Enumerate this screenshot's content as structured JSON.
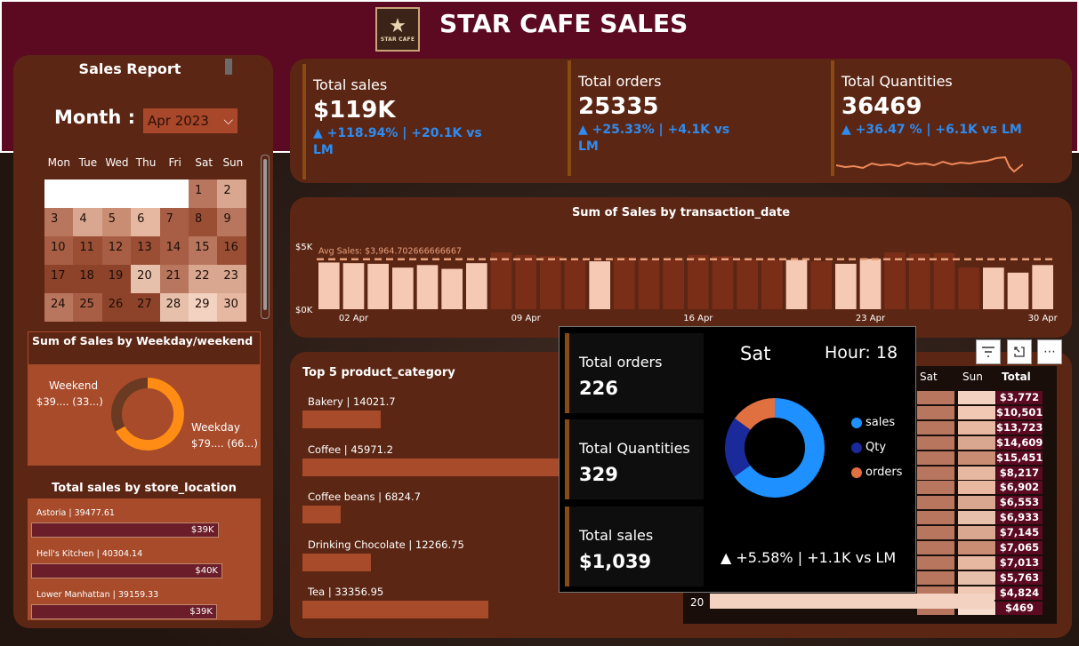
{
  "header": {
    "title": "STAR CAFE SALES",
    "logo_text": "STAR CAFE"
  },
  "sidebar": {
    "title": "Sales Report",
    "month_label": "Month :",
    "month_value": "Apr 2023",
    "weekdays": [
      "Mon",
      "Tue",
      "Wed",
      "Thu",
      "Fri",
      "Sat",
      "Sun"
    ],
    "calendar_rows": [
      [
        "",
        "",
        "",
        "",
        "",
        "1",
        "2"
      ],
      [
        "3",
        "4",
        "5",
        "6",
        "7",
        "8",
        "9"
      ],
      [
        "10",
        "11",
        "12",
        "13",
        "14",
        "15",
        "16"
      ],
      [
        "17",
        "18",
        "19",
        "20",
        "21",
        "22",
        "23"
      ],
      [
        "24",
        "25",
        "26",
        "27",
        "28",
        "29",
        "30"
      ]
    ],
    "calendar_shades": [
      [
        "#ffffff",
        "#ffffff",
        "#ffffff",
        "#ffffff",
        "#ffffff",
        "#b9765e",
        "#d9a68f"
      ],
      [
        "#b9765e",
        "#d9a68f",
        "#c98d74",
        "#e6b8a2",
        "#a85e44",
        "#9a4f35",
        "#b9765e"
      ],
      [
        "#a85e44",
        "#9a4f35",
        "#a85e44",
        "#9a4f35",
        "#a85e44",
        "#b9765e",
        "#9a4f35"
      ],
      [
        "#8d4329",
        "#8d4329",
        "#8d4329",
        "#e6c0ab",
        "#b9765e",
        "#d9a68f",
        "#d9a68f"
      ],
      [
        "#b9765e",
        "#a85e44",
        "#8d4329",
        "#8d4329",
        "#e6c0ab",
        "#f3d2c1",
        "#e6b8a2"
      ]
    ]
  },
  "weekday_panel": {
    "title": "Sum of Sales by Weekday/weekend",
    "weekend_label": "Weekend",
    "weekend_value": "$39.... (33...)",
    "weekday_label": "Weekday",
    "weekday_value": "$79.... (66...)",
    "weekend_share": 0.33,
    "colors": {
      "weekday": "#ff8c14",
      "weekend": "#6b3a22"
    }
  },
  "store_panel": {
    "title": "Total sales by store_location",
    "stores": [
      {
        "label": "Astoria | 39477.61",
        "value": 39477.61,
        "badge": "$39K"
      },
      {
        "label": "Hell's Kitchen | 40304.14",
        "value": 40304.14,
        "badge": "$40K"
      },
      {
        "label": "Lower Manhattan | 39159.33",
        "value": 39159.33,
        "badge": "$39K"
      }
    ]
  },
  "kpis": [
    {
      "label": "Total sales",
      "value": "$119K",
      "delta": "▲ +118.94% | +20.1K vs LM"
    },
    {
      "label": "Total orders",
      "value": "25335",
      "delta": "▲ +25.33% | +4.1K vs LM"
    },
    {
      "label": "Total Quantities",
      "value": "36469",
      "delta": "▲ +36.47 % | +6.1K vs LM"
    }
  ],
  "chart_data": {
    "type": "bar",
    "title": "Sum of Sales by transaction_date",
    "xlabel": "",
    "ylabel": "",
    "ylim": [
      0,
      5000
    ],
    "yticks": [
      "$0K",
      "$5K"
    ],
    "avg_label": "Avg Sales: $3,964.702666666667",
    "avg_value": 3964.7,
    "xticks": [
      "02 Apr",
      "09 Apr",
      "16 Apr",
      "23 Apr",
      "30 Apr"
    ],
    "categories": [
      "1",
      "2",
      "3",
      "4",
      "5",
      "6",
      "7",
      "8",
      "9",
      "10",
      "11",
      "12",
      "13",
      "14",
      "15",
      "16",
      "17",
      "18",
      "19",
      "20",
      "21",
      "22",
      "23",
      "24",
      "25",
      "26",
      "27",
      "28",
      "29",
      "30"
    ],
    "values": [
      3700,
      3650,
      3600,
      3300,
      3500,
      3200,
      3650,
      4500,
      4300,
      4200,
      3900,
      3800,
      4100,
      4000,
      4050,
      4300,
      4200,
      4000,
      3950,
      3900,
      3800,
      3600,
      4000,
      4500,
      4400,
      4450,
      3300,
      3300,
      2900,
      3500
    ],
    "highlighted": [
      true,
      true,
      true,
      true,
      true,
      true,
      true,
      false,
      false,
      false,
      false,
      true,
      false,
      false,
      false,
      false,
      false,
      false,
      false,
      true,
      false,
      true,
      true,
      false,
      false,
      false,
      false,
      true,
      true,
      true
    ],
    "colors": {
      "highlight": "#f6c9b4",
      "dim": "#7a2e18",
      "avg_line": "#e8a07a"
    }
  },
  "categories_panel": {
    "title": "Top 5 product_category",
    "items": [
      {
        "label": "Bakery | 14021.7",
        "value": 14021.7
      },
      {
        "label": "Coffee | 45971.2",
        "value": 45971.2
      },
      {
        "label": "Coffee beans | 6824.7",
        "value": 6824.7
      },
      {
        "label": "Drinking Chocolate | 12266.75",
        "value": 12266.75
      },
      {
        "label": "Tea | 33356.95",
        "value": 33356.95
      }
    ]
  },
  "tooltip": {
    "day": "Sat",
    "hour": "Hour: 18",
    "cards": [
      {
        "label": "Total orders",
        "value": "226"
      },
      {
        "label": "Total Quantities",
        "value": "329"
      },
      {
        "label": "Total sales",
        "value": "$1,039"
      }
    ],
    "legend": [
      {
        "label": "sales",
        "color": "#1e90ff"
      },
      {
        "label": "Qty",
        "color": "#1a2a9a"
      },
      {
        "label": "orders",
        "color": "#e07040"
      }
    ],
    "donut_shares": [
      0.65,
      0.2,
      0.15
    ],
    "delta": "▲ +5.58% | +1.1K vs LM"
  },
  "heatmap_table": {
    "col_headers": [
      "Sat",
      "Sun",
      "Total"
    ],
    "last_row_label": "20",
    "totals": [
      "$3,772",
      "$10,501",
      "$13,723",
      "$14,609",
      "$15,451",
      "$8,217",
      "$6,902",
      "$6,553",
      "$6,933",
      "$7,145",
      "$7,065",
      "$7,013",
      "$5,763",
      "$4,824",
      "$469"
    ],
    "icons": {
      "filter": "filter-icon",
      "expand": "focus-mode-icon",
      "more": "more-options-icon"
    }
  }
}
